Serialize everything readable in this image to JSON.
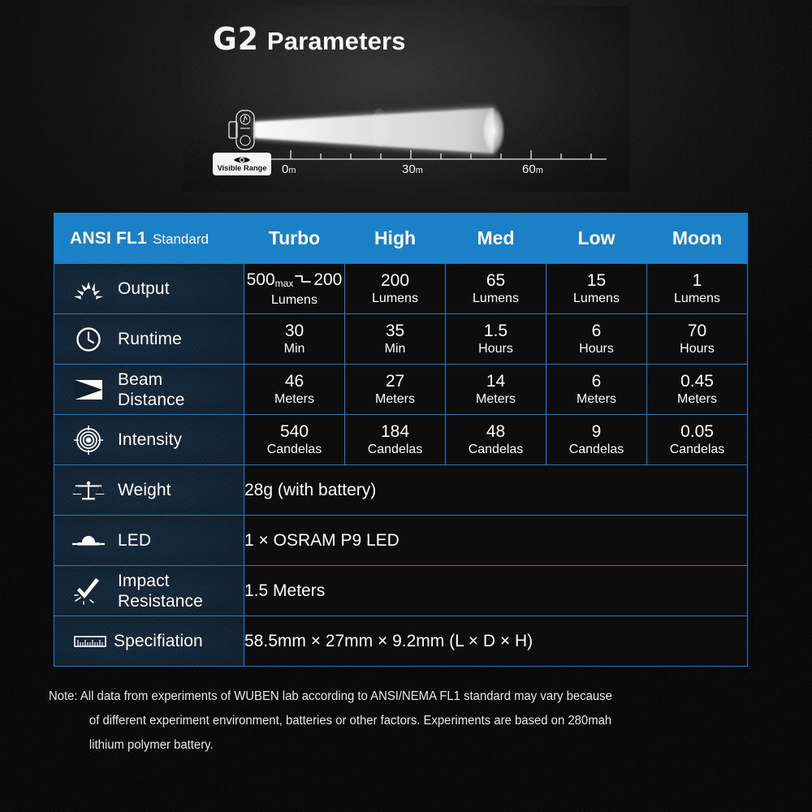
{
  "header": {
    "model": "G2",
    "title": "Parameters"
  },
  "beam_diagram": {
    "visible_range_label": "Visible Range",
    "eye_icon": "eye-icon",
    "flashlight_icon": "flashlight-icon",
    "ticks": [
      {
        "value": "0",
        "unit": "m"
      },
      {
        "value": "30",
        "unit": "m"
      },
      {
        "value": "60",
        "unit": "m"
      }
    ]
  },
  "table": {
    "header": {
      "standard_bold": "ANSI FL1",
      "standard_light": "Standard",
      "modes": [
        "Turbo",
        "High",
        "Med",
        "Low",
        "Moon"
      ]
    },
    "rows": [
      {
        "icon": "sunburst-icon",
        "label": "Output",
        "type": "modes",
        "values": [
          {
            "num_pre": "500",
            "sub": "max",
            "step": true,
            "num_post": "200",
            "unit": "Lumens"
          },
          {
            "num": "200",
            "unit": "Lumens"
          },
          {
            "num": "65",
            "unit": "Lumens"
          },
          {
            "num": "15",
            "unit": "Lumens"
          },
          {
            "num": "1",
            "unit": "Lumens"
          }
        ]
      },
      {
        "icon": "clock-icon",
        "label": "Runtime",
        "type": "modes",
        "values": [
          {
            "num": "30",
            "unit": "Min"
          },
          {
            "num": "35",
            "unit": "Min"
          },
          {
            "num": "1.5",
            "unit": "Hours"
          },
          {
            "num": "6",
            "unit": "Hours"
          },
          {
            "num": "70",
            "unit": "Hours"
          }
        ]
      },
      {
        "icon": "beam-distance-icon",
        "label": "Beam Distance",
        "label_line1": "Beam",
        "label_line2": "Distance",
        "type": "modes",
        "values": [
          {
            "num": "46",
            "unit": "Meters"
          },
          {
            "num": "27",
            "unit": "Meters"
          },
          {
            "num": "14",
            "unit": "Meters"
          },
          {
            "num": "6",
            "unit": "Meters"
          },
          {
            "num": "0.45",
            "unit": "Meters"
          }
        ]
      },
      {
        "icon": "target-icon",
        "label": "Intensity",
        "type": "modes",
        "values": [
          {
            "num": "540",
            "unit": "Candelas"
          },
          {
            "num": "184",
            "unit": "Candelas"
          },
          {
            "num": "48",
            "unit": "Candelas"
          },
          {
            "num": "9",
            "unit": "Candelas"
          },
          {
            "num": "0.05",
            "unit": "Candelas"
          }
        ]
      },
      {
        "icon": "scale-icon",
        "label": "Weight",
        "type": "span",
        "value": "28g (with battery)"
      },
      {
        "icon": "led-icon",
        "label": "LED",
        "type": "span",
        "value": "1 × OSRAM P9 LED"
      },
      {
        "icon": "impact-icon",
        "label": "Impact Resistance",
        "label_line1": "Impact",
        "label_line2": "Resistance",
        "type": "span",
        "value": "1.5 Meters"
      },
      {
        "icon": "ruler-icon",
        "label": "Specifiation",
        "type": "span",
        "value": "58.5mm × 27mm × 9.2mm (L × D × H)"
      }
    ]
  },
  "note": {
    "line1": "Note: All data from experiments of WUBEN lab according to ANSI/NEMA FL1 standard may vary because",
    "line2": "of different experiment environment, batteries or other factors. Experiments are based on  280mah",
    "line3": "lithium polymer battery."
  },
  "colors": {
    "accent_blue": "#1b80c6",
    "grid_blue": "#2e77b0",
    "label_bg": "#10202f",
    "data_bg": "#0d0d0d",
    "page_bg": "#0a0a0a"
  }
}
